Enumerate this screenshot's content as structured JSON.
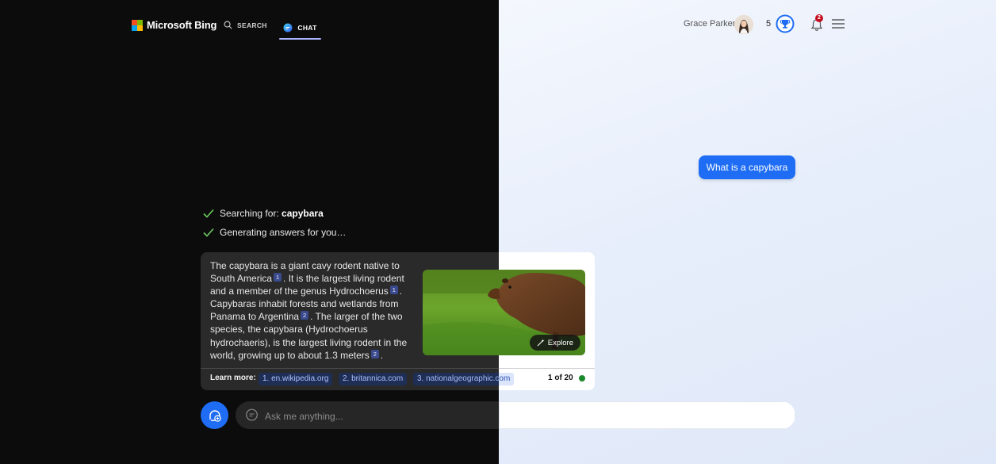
{
  "header": {
    "brand": "Microsoft Bing",
    "nav": {
      "search_label": "SEARCH",
      "chat_label": "CHAT"
    },
    "user_name": "Grace Parker",
    "rewards_points": "5",
    "notifications_count": "2"
  },
  "conversation": {
    "user_message": "What is a capybara",
    "progress": {
      "searching_prefix": "Searching for: ",
      "searching_term": "capybara",
      "generating": "Generating answers for you…"
    },
    "answer": {
      "segments": [
        "The capybara is a giant cavy rodent native to South America",
        ". It is the largest living rodent and a member of the genus Hydrochoerus",
        ". Capybaras inhabit forests and wetlands from Panama to Argentina",
        ". The larger of the two species, the capybara (Hydrochoerus hydrochaeris), is the largest living rodent in the world, growing up to about 1.3 meters",
        "."
      ],
      "citations": [
        "1",
        "1",
        "2",
        "2"
      ],
      "explore_label": "Explore",
      "learn_more_label": "Learn more:",
      "sources": [
        "1. en.wikipedia.org",
        "2. britannica.com",
        "3. nationalgeographic.com"
      ],
      "page_counter": "1 of 20"
    }
  },
  "input": {
    "placeholder": "Ask me anything..."
  },
  "colors": {
    "accent": "#1e6df4",
    "dark_bg": "#0c0c0c",
    "light_bg": "#e7eefb",
    "check": "#6ccb5f",
    "status_green": "#1a8a2c",
    "badge_red": "#c50f1f"
  }
}
